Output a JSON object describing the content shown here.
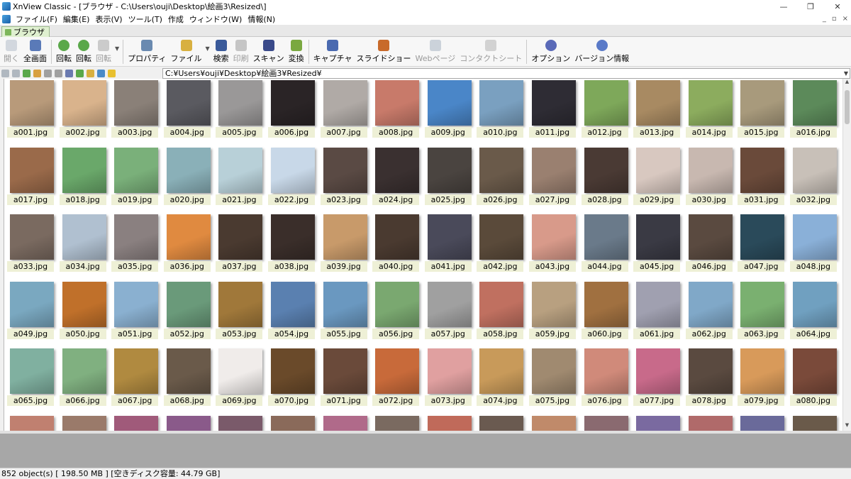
{
  "window": {
    "title": "XnView Classic - [ブラウザ - C:\\Users\\ouji\\Desktop\\絵画3\\Resized\\]",
    "controls": [
      "—",
      "❐",
      "✕"
    ]
  },
  "menu": [
    "ファイル(F)",
    "編集(E)",
    "表示(V)",
    "ツール(T)",
    "作成",
    "ウィンドウ(W)",
    "情報(N)"
  ],
  "mdi_controls": [
    "_",
    "▫",
    "×"
  ],
  "tab": {
    "label": "ブラウザ"
  },
  "toolbar": {
    "open": "開く",
    "fullscreen": "全画面",
    "rotate_left": "回転",
    "rotate_right": "回転",
    "rotate_disabled": "回転",
    "properties": "プロパティ",
    "file": "ファイル",
    "search": "検索",
    "print": "印刷",
    "scan": "スキャン",
    "convert": "変換",
    "capture": "キャプチャ",
    "slideshow": "スライドショー",
    "webpage": "Webページ",
    "contact_sheet": "コンタクトシート",
    "options": "オプション",
    "version": "バージョン情報"
  },
  "address": {
    "path": "C:¥Users¥ouji¥Desktop¥絵画3¥Resized¥"
  },
  "files": [
    "a001.jpg",
    "a002.jpg",
    "a003.jpg",
    "a004.jpg",
    "a005.jpg",
    "a006.jpg",
    "a007.jpg",
    "a008.jpg",
    "a009.jpg",
    "a010.jpg",
    "a011.jpg",
    "a012.jpg",
    "a013.jpg",
    "a014.jpg",
    "a015.jpg",
    "a016.jpg",
    "a017.jpg",
    "a018.jpg",
    "a019.jpg",
    "a020.jpg",
    "a021.jpg",
    "a022.jpg",
    "a023.jpg",
    "a024.jpg",
    "a025.jpg",
    "a026.jpg",
    "a027.jpg",
    "a028.jpg",
    "a029.jpg",
    "a030.jpg",
    "a031.jpg",
    "a032.jpg",
    "a033.jpg",
    "a034.jpg",
    "a035.jpg",
    "a036.jpg",
    "a037.jpg",
    "a038.jpg",
    "a039.jpg",
    "a040.jpg",
    "a041.jpg",
    "a042.jpg",
    "a043.jpg",
    "a044.jpg",
    "a045.jpg",
    "a046.jpg",
    "a047.jpg",
    "a048.jpg",
    "a049.jpg",
    "a050.jpg",
    "a051.jpg",
    "a052.jpg",
    "a053.jpg",
    "a054.jpg",
    "a055.jpg",
    "a056.jpg",
    "a057.jpg",
    "a058.jpg",
    "a059.jpg",
    "a060.jpg",
    "a061.jpg",
    "a062.jpg",
    "a063.jpg",
    "a064.jpg",
    "a065.jpg",
    "a066.jpg",
    "a067.jpg",
    "a068.jpg",
    "a069.jpg",
    "a070.jpg",
    "a071.jpg",
    "a072.jpg",
    "a073.jpg",
    "a074.jpg",
    "a075.jpg",
    "a076.jpg",
    "a077.jpg",
    "a078.jpg",
    "a079.jpg",
    "a080.jpg",
    "",
    "",
    "",
    "",
    "",
    "",
    "",
    "",
    "",
    "",
    "",
    "",
    "",
    "",
    "",
    ""
  ],
  "thumb_colors": [
    "#b89a7a",
    "#d9b38c",
    "#8a8078",
    "#5a5a60",
    "#9a9898",
    "#2a2426",
    "#b0aaa6",
    "#c87a6a",
    "#4a86c8",
    "#7aa0c0",
    "#2e2c34",
    "#7ea85a",
    "#a88a62",
    "#8cac5e",
    "#a89a7c",
    "#5c8a5a",
    "#9a6a4a",
    "#6aa86a",
    "#7ab07a",
    "#8ab0b8",
    "#b8d0d8",
    "#c8d8e8",
    "#5a4a44",
    "#3a3030",
    "#4a4440",
    "#6a5a4a",
    "#9a8070",
    "#4a3a34",
    "#d8c8c0",
    "#c8b8b0",
    "#6a4a3a",
    "#c8c0b8",
    "#7a6a60",
    "#b0c0d0",
    "#8a8080",
    "#e08a40",
    "#4a3a30",
    "#3a2e2a",
    "#c89a6a",
    "#4a3a30",
    "#4a4a5a",
    "#5a4a3a",
    "#d89a8a",
    "#6a7a8a",
    "#3a3a44",
    "#5a4a40",
    "#2a4a5a",
    "#8ab0d8",
    "#7aa8c0",
    "#c0702a",
    "#8ab0d0",
    "#6a9a7a",
    "#a0783a",
    "#5a80b0",
    "#6a98c0",
    "#7aa870",
    "#a0a0a0",
    "#c07060",
    "#b8a080",
    "#a07040",
    "#a0a0b0",
    "#80a8c8",
    "#7ab070",
    "#70a0c0",
    "#80b0a0",
    "#80b080",
    "#b08a40",
    "#6a5a4a",
    "#f0ecea",
    "#6a4a2a",
    "#6a4a3a",
    "#c86a3a",
    "#e0a0a0",
    "#c89a5a",
    "#a08a70",
    "#d08a7a",
    "#c86a8a",
    "#5a4a40",
    "#d89a5a",
    "#7a4a3a",
    "#c08070",
    "#9a7a6a",
    "#a05a7a",
    "#8a5a8a",
    "#7a5a6a",
    "#8a6a5a",
    "#b06a8a",
    "#7a6a60",
    "#c06a5a",
    "#6a5a50",
    "#c08a6a",
    "#8a6a70",
    "#7a6aa0",
    "#b06a6a",
    "#6a6a9a",
    "#6a5a4a"
  ],
  "status": {
    "text": "852 object(s) [ 198.50 MB ] [空きディスク容量: 44.79 GB]"
  }
}
